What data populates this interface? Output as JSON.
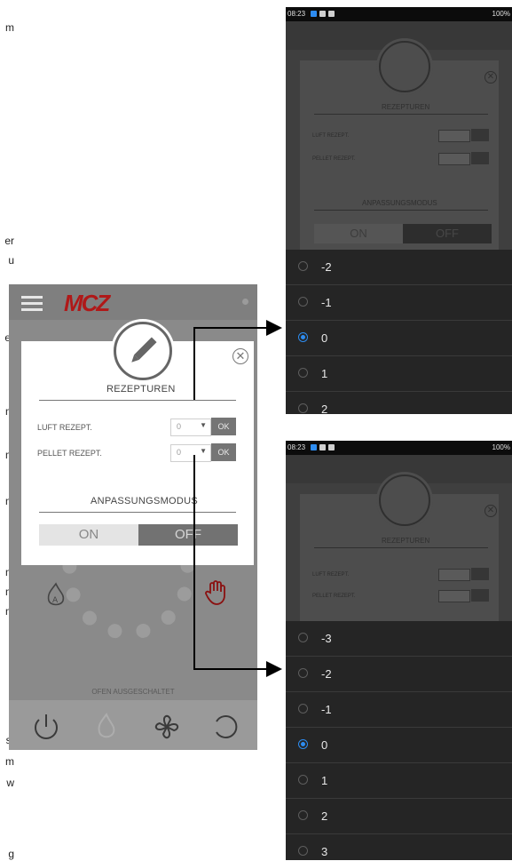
{
  "left_fragments": [
    "m",
    "er",
    "u",
    "er",
    "m",
    "m",
    "m",
    "m",
    "m",
    "m",
    "st",
    "m",
    "w",
    "g"
  ],
  "left_screen": {
    "logo": "MCZ",
    "status_text": "OFEN AUSGESCHALTET",
    "dialog": {
      "section1_title": "REZEPTUREN",
      "rows": [
        {
          "label": "LUFT REZEPT.",
          "value": "0",
          "ok": "OK"
        },
        {
          "label": "PELLET REZEPT.",
          "value": "0",
          "ok": "OK"
        }
      ],
      "section2_title": "ANPASSUNGSMODUS",
      "toggle_on": "ON",
      "toggle_off": "OFF"
    }
  },
  "screen_top": {
    "status_time": "08:23",
    "status_right": "100%",
    "dialog": {
      "section1_title": "REZEPTUREN",
      "rows": [
        {
          "label": "LUFT REZEPT."
        },
        {
          "label": "PELLET REZEPT."
        }
      ],
      "section2_title": "ANPASSUNGSMODUS",
      "toggle_on": "ON",
      "toggle_off": "OFF"
    },
    "options": [
      "-2",
      "-1",
      "0",
      "1",
      "2"
    ],
    "selected": "0"
  },
  "screen_bottom": {
    "status_time": "08:23",
    "status_right": "100%",
    "dialog": {
      "section1_title": "REZEPTUREN",
      "rows": [
        {
          "label": "LUFT REZEPT."
        },
        {
          "label": "PELLET REZEPT."
        }
      ]
    },
    "options": [
      "-3",
      "-2",
      "-1",
      "0",
      "1",
      "2",
      "3"
    ],
    "selected": "0"
  },
  "colors": {
    "accent_radio": "#2d8cf0",
    "logo_red": "#b01818"
  }
}
